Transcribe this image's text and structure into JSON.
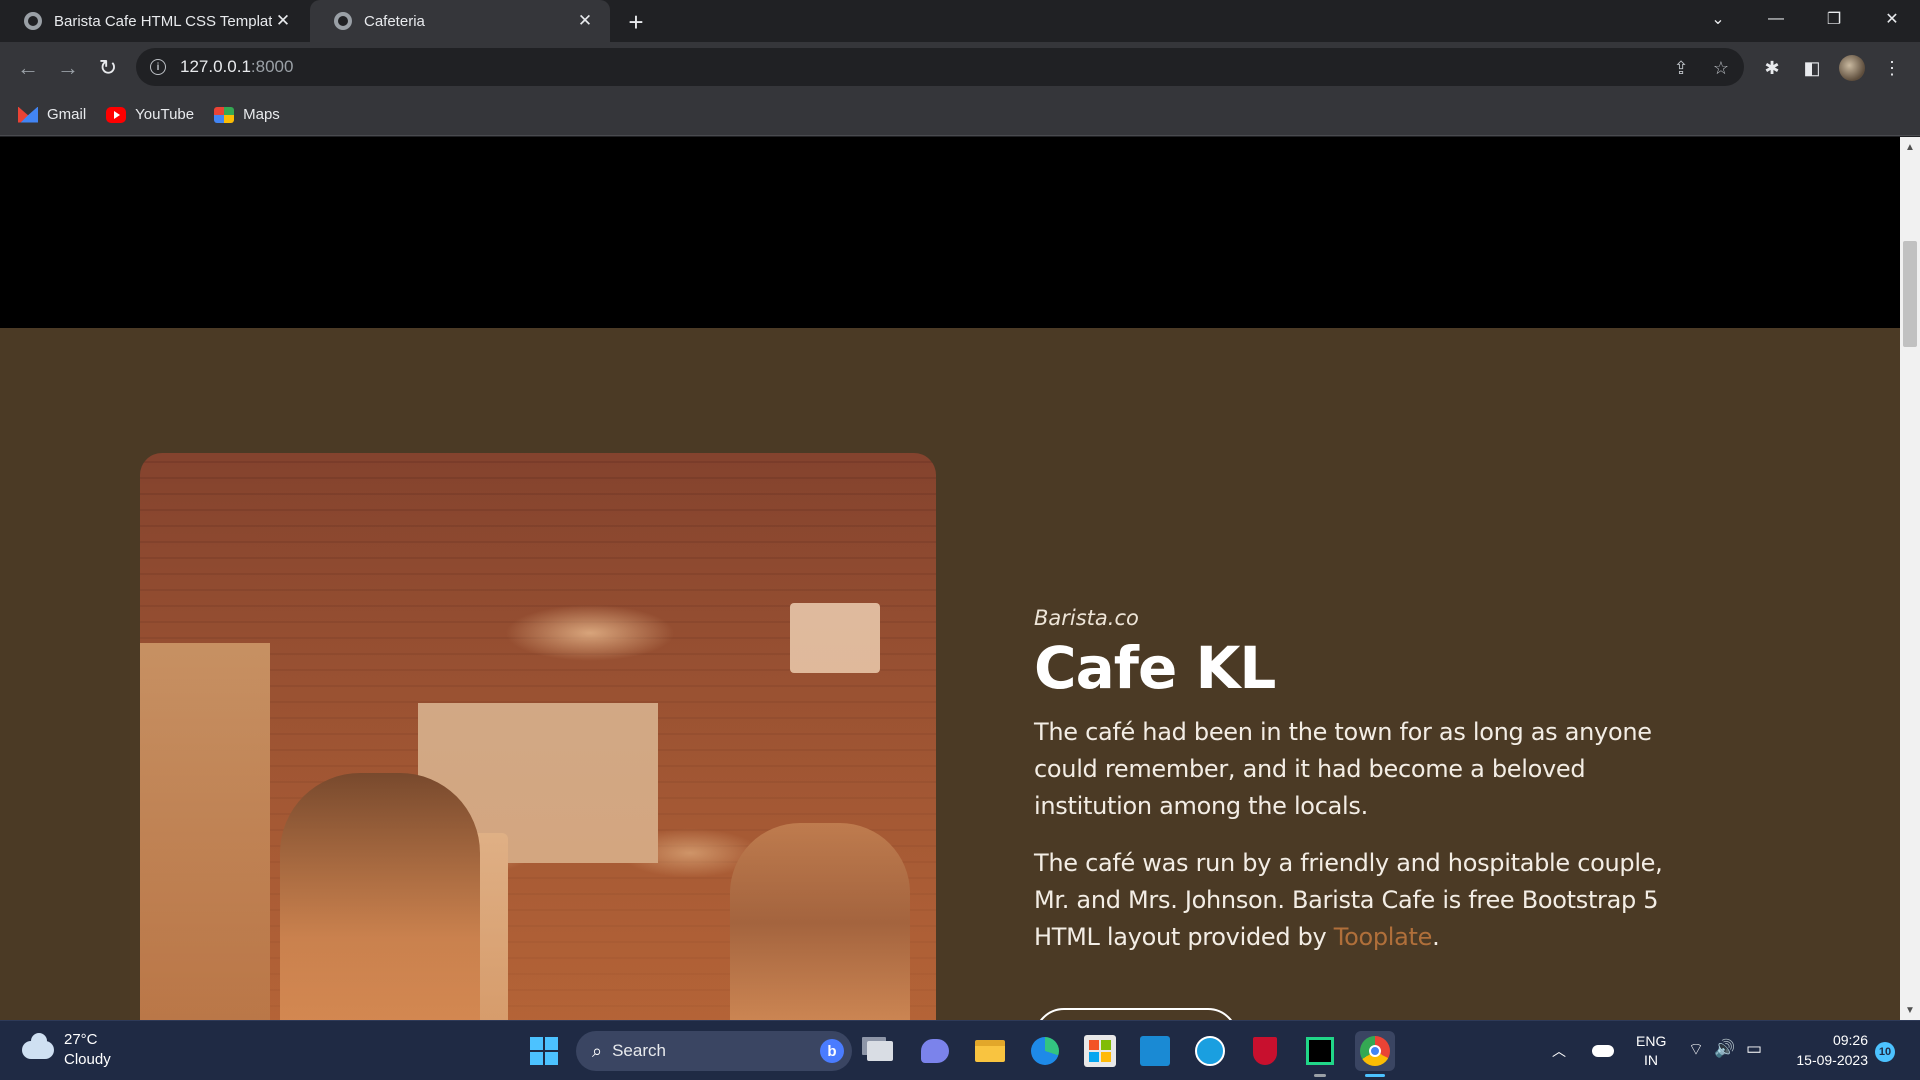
{
  "browser": {
    "tabs": [
      {
        "title": "Barista Cafe HTML CSS Template",
        "close": "✕"
      },
      {
        "title": "Cafeteria",
        "close": "✕"
      }
    ],
    "new_tab": "+",
    "window_controls": {
      "tab_search": "⌄",
      "minimize": "—",
      "restore": "❐",
      "close": "✕"
    },
    "toolbar": {
      "back": "←",
      "forward": "→",
      "reload": "↻",
      "info": "i"
    },
    "url": {
      "host": "127.0.0.1",
      "port": ":8000"
    },
    "omnibox_icons": {
      "share": "⇪",
      "bookmark": "☆"
    },
    "toolbar_right_icons": {
      "extensions": "✱",
      "side_panel": "◧",
      "menu": "⋮"
    },
    "bookmarks": [
      {
        "label": "Gmail",
        "icon": "gmail-icon"
      },
      {
        "label": "YouTube",
        "icon": "youtube-icon"
      },
      {
        "label": "Maps",
        "icon": "maps-icon"
      }
    ]
  },
  "page": {
    "about": {
      "kicker": "Barista.co",
      "heading": "Cafe KL",
      "paragraph1": "The café had been in the town for as long as anyone could remember, and it had become a beloved institution among the locals.",
      "paragraph2_prefix": "The café was run by a friendly and hospitable couple, Mr. and Mrs. Johnson. Barista Cafe is free Bootstrap 5 HTML layout provided by ",
      "paragraph2_link": "Tooplate",
      "paragraph2_suffix": "."
    },
    "colors": {
      "section_bg": "#4b3a25",
      "hero_bg": "#000000",
      "link": "#b06f3a"
    }
  },
  "scrollbar": {
    "up": "▲",
    "down": "▼"
  },
  "taskbar": {
    "weather": {
      "temp": "27°C",
      "condition": "Cloudy"
    },
    "search": {
      "placeholder": "Search",
      "glass": "⌕",
      "bing": "b"
    },
    "apps": [
      "start",
      "search",
      "task-view",
      "teams-chat",
      "file-explorer",
      "edge",
      "store",
      "myhp",
      "get-help",
      "mcafee",
      "pycharm",
      "chrome"
    ],
    "tray": {
      "chevron": "︿",
      "lang_line1": "ENG",
      "lang_line2": "IN",
      "wifi": "⌔",
      "volume": "🔊",
      "battery": "▭"
    },
    "clock": {
      "time": "09:26",
      "date": "15-09-2023"
    },
    "notifications": "10"
  }
}
